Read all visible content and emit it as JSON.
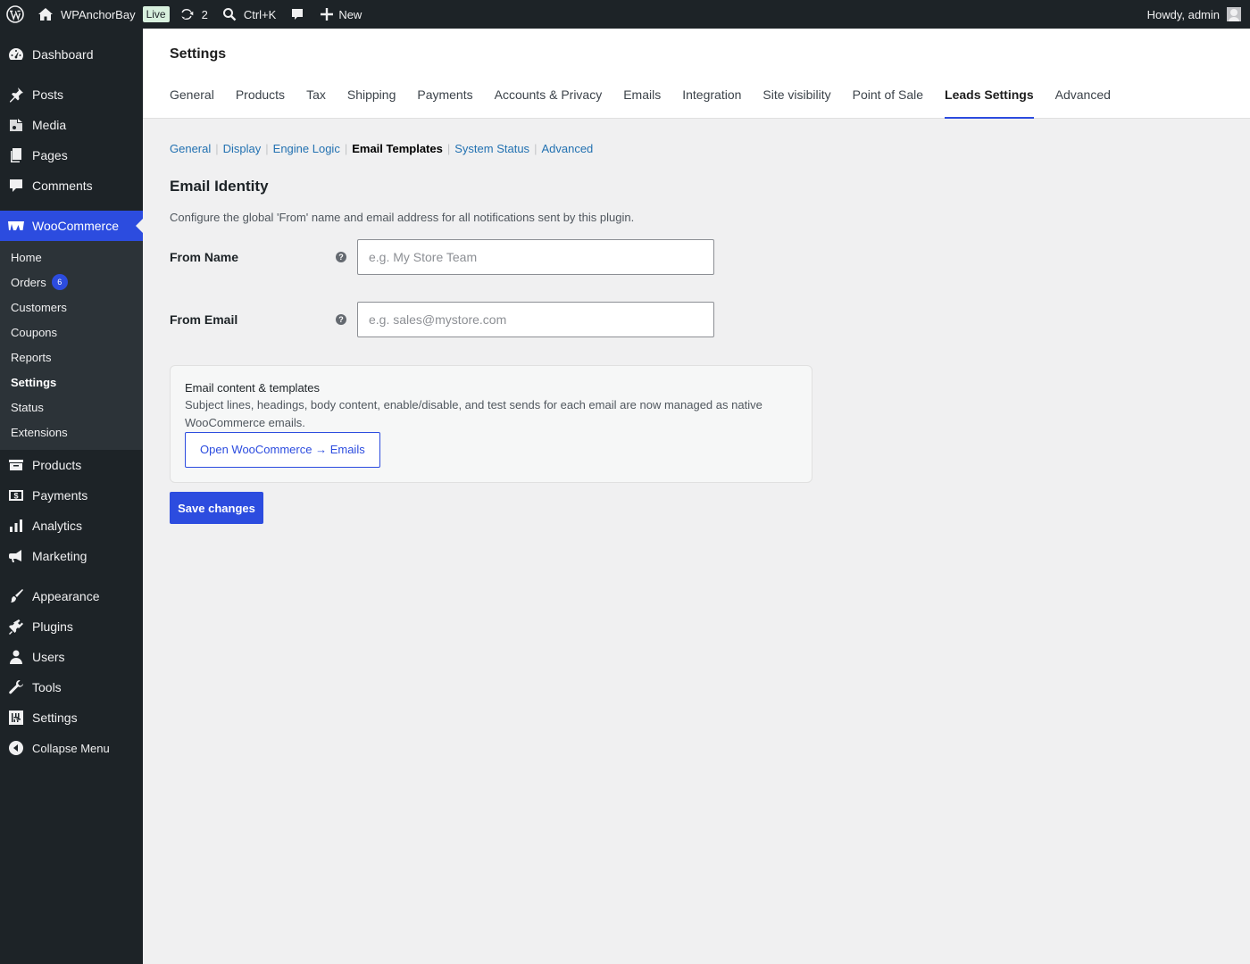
{
  "adminbar": {
    "site_name": "WPAnchorBay",
    "live_badge": "Live",
    "updates_count": "2",
    "search_shortcut": "Ctrl+K",
    "new_label": "New",
    "howdy": "Howdy, admin"
  },
  "sidebar": {
    "items_top": [
      {
        "label": "Dashboard",
        "icon": "dashboard-icon"
      },
      {
        "label": "Posts",
        "icon": "pin-icon"
      },
      {
        "label": "Media",
        "icon": "media-icon"
      },
      {
        "label": "Pages",
        "icon": "pages-icon"
      },
      {
        "label": "Comments",
        "icon": "comment-icon"
      }
    ],
    "woocommerce_label": "WooCommerce",
    "woo_submenu": [
      {
        "label": "Home"
      },
      {
        "label": "Orders",
        "badge": "6"
      },
      {
        "label": "Customers"
      },
      {
        "label": "Coupons"
      },
      {
        "label": "Reports"
      },
      {
        "label": "Settings"
      },
      {
        "label": "Status"
      },
      {
        "label": "Extensions"
      }
    ],
    "items_mid": [
      {
        "label": "Products"
      },
      {
        "label": "Payments"
      },
      {
        "label": "Analytics"
      },
      {
        "label": "Marketing"
      }
    ],
    "items_bottom": [
      {
        "label": "Appearance"
      },
      {
        "label": "Plugins"
      },
      {
        "label": "Users"
      },
      {
        "label": "Tools"
      },
      {
        "label": "Settings"
      },
      {
        "label": "Collapse Menu"
      }
    ]
  },
  "header": {
    "title": "Settings",
    "tabs": [
      "General",
      "Products",
      "Tax",
      "Shipping",
      "Payments",
      "Accounts & Privacy",
      "Emails",
      "Integration",
      "Site visibility",
      "Point of Sale",
      "Leads Settings",
      "Advanced"
    ],
    "active_tab": "Leads Settings"
  },
  "subtabs": [
    "General",
    "Display",
    "Engine Logic",
    "Email Templates",
    "System Status",
    "Advanced"
  ],
  "active_subtab": "Email Templates",
  "section": {
    "title": "Email Identity",
    "description": "Configure the global 'From' name and email address for all notifications sent by this plugin.",
    "from_name_label": "From Name",
    "from_name_placeholder": "e.g. My Store Team",
    "from_email_label": "From Email",
    "from_email_placeholder": "e.g. sales@mystore.com"
  },
  "info_box": {
    "title": "Email content & templates",
    "text": "Subject lines, headings, body content, enable/disable, and test sends for each email are now managed as native WooCommerce emails.",
    "button": "Open WooCommerce → Emails"
  },
  "save_button": "Save changes",
  "colors": {
    "accent": "#2c4cdf",
    "adminbar_bg": "#1d2327",
    "link": "#2271b1"
  }
}
